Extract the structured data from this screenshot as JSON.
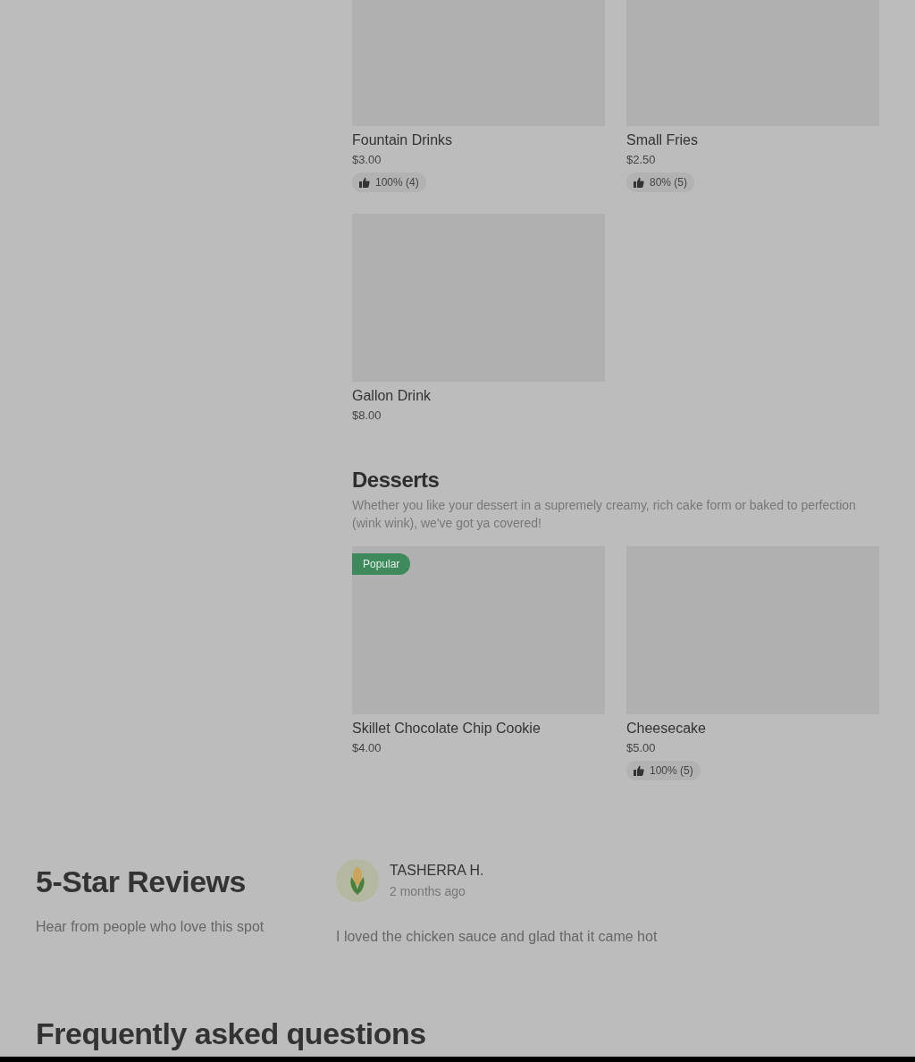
{
  "drinks": {
    "items": [
      {
        "name": "Fountain Drinks",
        "price": "$3.00",
        "rating": "100% (4)"
      },
      {
        "name": "Small Fries",
        "price": "$2.50",
        "rating": "80% (5)"
      },
      {
        "name": "Gallon Drink",
        "price": "$8.00"
      }
    ]
  },
  "desserts": {
    "title": "Desserts",
    "description": "Whether you like your dessert in a supremely creamy, rich cake form or baked to perfection (wink wink), we've got ya covered!",
    "items": [
      {
        "badge": "Popular",
        "name": "Skillet Chocolate Chip Cookie",
        "price": "$4.00"
      },
      {
        "name": "Cheesecake",
        "price": "$5.00",
        "rating": "100% (5)"
      }
    ]
  },
  "reviews": {
    "title": "5-Star Reviews",
    "subtitle": "Hear from people who love this spot",
    "items": [
      {
        "author": "TASHERRA H.",
        "time": "2 months ago",
        "text": "I loved the chicken sauce and glad that it came hot"
      }
    ]
  },
  "faq": {
    "title": "Frequently asked questions"
  }
}
